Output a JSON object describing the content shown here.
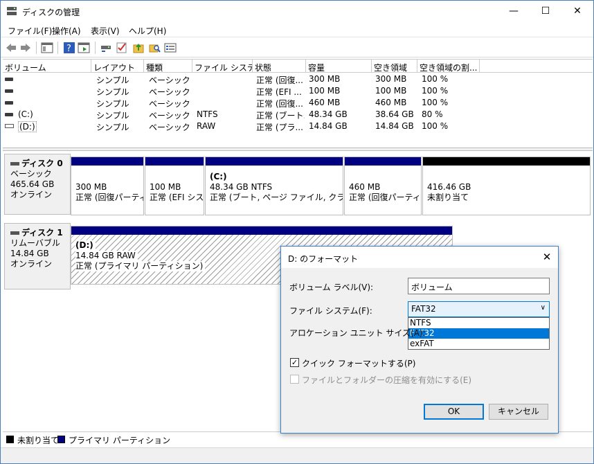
{
  "window": {
    "title": "ディスクの管理",
    "minimize": "—",
    "maximize": "☐",
    "close": "✕"
  },
  "menu": [
    "ファイル(F)",
    "操作(A)",
    "表示(V)",
    "ヘルプ(H)"
  ],
  "list": {
    "headers": [
      "ボリューム",
      "レイアウト",
      "種類",
      "ファイル システム",
      "状態",
      "容量",
      "空き領域",
      "空き領域の割..."
    ],
    "rows": [
      {
        "volume": "",
        "layout": "シンプル",
        "type": "ベーシック",
        "fs": "",
        "status": "正常 (回復...",
        "capacity": "300 MB",
        "free": "300 MB",
        "pct": "100 %"
      },
      {
        "volume": "",
        "layout": "シンプル",
        "type": "ベーシック",
        "fs": "",
        "status": "正常 (EFI ...",
        "capacity": "100 MB",
        "free": "100 MB",
        "pct": "100 %"
      },
      {
        "volume": "",
        "layout": "シンプル",
        "type": "ベーシック",
        "fs": "",
        "status": "正常 (回復...",
        "capacity": "460 MB",
        "free": "460 MB",
        "pct": "100 %"
      },
      {
        "volume": "(C:)",
        "layout": "シンプル",
        "type": "ベーシック",
        "fs": "NTFS",
        "status": "正常 (ブート...",
        "capacity": "48.34 GB",
        "free": "38.64 GB",
        "pct": "80 %"
      },
      {
        "volume": "(D:)",
        "layout": "シンプル",
        "type": "ベーシック",
        "fs": "RAW",
        "status": "正常 (プラ...",
        "capacity": "14.84 GB",
        "free": "14.84 GB",
        "pct": "100 %"
      }
    ]
  },
  "disk0": {
    "name": "ディスク 0",
    "type": "ベーシック",
    "size": "465.64 GB",
    "state": "オンライン",
    "partitions": [
      {
        "label": "",
        "size": "300 MB",
        "status": "正常 (回復パーティ"
      },
      {
        "label": "",
        "size": "100 MB",
        "status": "正常 (EFI シス"
      },
      {
        "label": "(C:)",
        "size": "48.34 GB NTFS",
        "status": "正常 (ブート, ページ ファイル, クラッシュ ダ"
      },
      {
        "label": "",
        "size": "460 MB",
        "status": "正常 (回復パーティシ"
      },
      {
        "label": "",
        "size": "416.46 GB",
        "status": "未割り当て"
      }
    ]
  },
  "disk1": {
    "name": "ディスク 1",
    "type": "リムーバブル",
    "size": "14.84 GB",
    "state": "オンライン",
    "partition": {
      "label": "(D:)",
      "size": "14.84 GB RAW",
      "status": "正常 (プライマリ パーティション)"
    }
  },
  "legend": {
    "unallocated": "未割り当て",
    "primary": "プライマリ パーティション"
  },
  "dialog": {
    "title": "D: のフォーマット",
    "volume_label_caption": "ボリューム ラベル(V):",
    "volume_label_value": "ボリューム",
    "fs_caption": "ファイル システム(F):",
    "fs_value": "FAT32",
    "fs_options": [
      "NTFS",
      "FAT32",
      "exFAT"
    ],
    "fs_selected": "FAT32",
    "alloc_caption": "アロケーション ユニット サイズ(A):",
    "quick_format": "クイック フォーマットする(P)",
    "quick_format_checked": true,
    "compress": "ファイルとフォルダーの圧縮を有効にする(E)",
    "ok": "OK",
    "cancel": "キャンセル"
  },
  "colors": {
    "primary_partition": "#000080",
    "unallocated": "#000000",
    "accent": "#0078d7"
  }
}
